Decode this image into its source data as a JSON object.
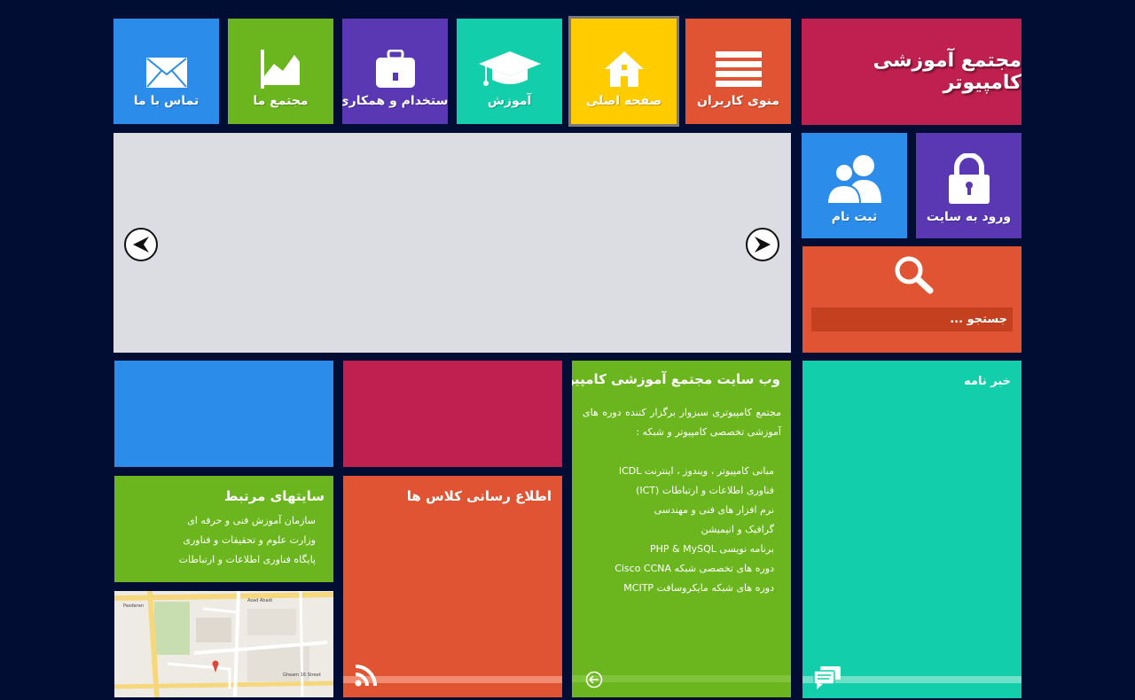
{
  "brand": {
    "title": "مجتمع آموزشی کامپیوتر"
  },
  "nav": [
    {
      "id": "users-menu",
      "label": "منوی کاربران",
      "icon": "menu-icon",
      "color": "#e05434"
    },
    {
      "id": "home",
      "label": "صفحه اصلی",
      "icon": "home-icon",
      "color": "#ffcc00"
    },
    {
      "id": "education",
      "label": "آموزش",
      "icon": "graduation-cap-icon",
      "color": "#13ceab"
    },
    {
      "id": "jobs",
      "label": "استخدام و همکاری",
      "icon": "briefcase-icon",
      "color": "#5a38b4"
    },
    {
      "id": "about",
      "label": "مجتمع ما",
      "icon": "chart-icon",
      "color": "#6bb51e"
    },
    {
      "id": "contact",
      "label": "تماس با ما",
      "icon": "mail-icon",
      "color": "#2b8de9"
    }
  ],
  "auth": {
    "login_label": "ورود به سایت",
    "register_label": "ثبت نام"
  },
  "search": {
    "placeholder": "جستجو ..."
  },
  "welcome": {
    "title": "وب سایت مجتمع آموزشی کامپیوتر",
    "intro": "مجتمع کامپیوتری سبزوار برگزار کننده دوره های آموزشی تخصصی کامپیوتر و شبکه :",
    "courses": [
      "مبانی کامپیوتر ، ویندوز ، اینترنت  ICDL",
      "فناوری اطلاعات و ارتباطات (ICT)",
      "نرم افزار های فنی و مهندسی",
      "گرافیک و انیمیشن",
      "برنامه نویسی PHP & MySQL",
      "دوره های تخصصی شبکه Cisco CCNA",
      "دوره های شبکه مایکروسافت MCITP"
    ]
  },
  "class_news": {
    "title": "اطلاع رسانی کلاس ها"
  },
  "newsletter": {
    "title": "خبر نامه"
  },
  "related_sites": {
    "title": "سایتهای مرتبط",
    "links": [
      "سازمان آموزش فنی و حرفه ای",
      "وزارت علوم و تحقیقات و فناوری",
      "پایگاه فناوری اطلاعات و ارتباطات"
    ]
  },
  "map": {
    "labels": [
      "Asad Abadi",
      "Gheam 16 Street",
      "Pasdaran"
    ]
  },
  "colors": {
    "background": "#020d33",
    "brand": "#c0204f",
    "blue": "#2b8de9",
    "purple": "#5a38b4",
    "orange": "#e05434",
    "green": "#6bb51e",
    "teal": "#13ceab",
    "yellow": "#ffcc00",
    "slider": "#dcdde3"
  }
}
